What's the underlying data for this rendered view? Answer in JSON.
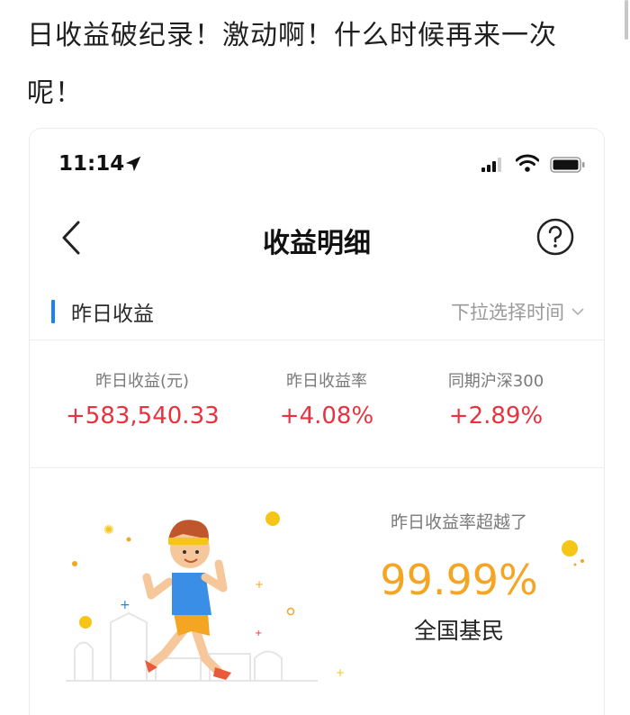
{
  "post": {
    "text": "日收益破纪录！激动啊！什么时候再来一次呢！"
  },
  "statusbar": {
    "time": "11:14",
    "icons": [
      "location-arrow-icon",
      "signal-icon",
      "wifi-icon",
      "battery-icon"
    ]
  },
  "nav": {
    "title": "收益明细",
    "back_icon": "chevron-left-icon",
    "help_icon": "question-circle-icon"
  },
  "section": {
    "title": "昨日收益",
    "time_select": "下拉选择时间",
    "accent_color": "#1b82f0"
  },
  "stats": [
    {
      "label": "昨日收益(元)",
      "value": "+583,540.33"
    },
    {
      "label": "昨日收益率",
      "value": "+4.08%"
    },
    {
      "label": "同期沪深300",
      "value": "+2.89%"
    }
  ],
  "rank": {
    "label": "昨日收益率超越了",
    "value": "99.99%",
    "suffix": "全国基民"
  },
  "colors": {
    "gain": "#e8323f",
    "highlight": "#f5a524",
    "accent": "#1b82f0"
  }
}
